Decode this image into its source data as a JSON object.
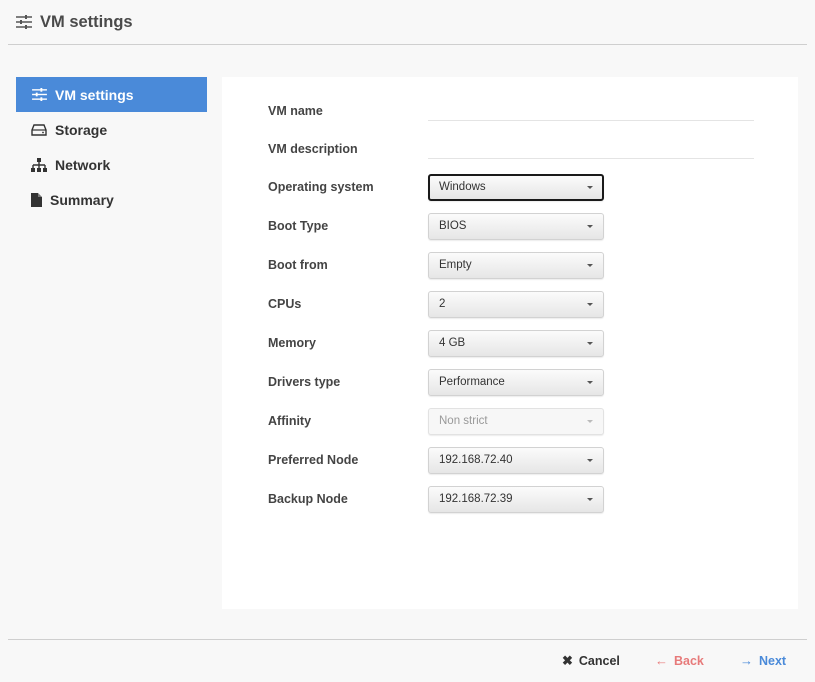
{
  "header": {
    "title": "VM settings",
    "icon": "sliders-icon"
  },
  "sidebar": {
    "items": [
      {
        "label": "VM settings",
        "icon": "sliders-icon",
        "active": true
      },
      {
        "label": "Storage",
        "icon": "hard-drive-icon",
        "active": false
      },
      {
        "label": "Network",
        "icon": "network-icon",
        "active": false
      },
      {
        "label": "Summary",
        "icon": "file-icon",
        "active": false
      }
    ]
  },
  "form": {
    "vm_name": {
      "label": "VM name",
      "value": "",
      "placeholder": ""
    },
    "vm_description": {
      "label": "VM description",
      "value": "",
      "placeholder": ""
    },
    "operating_system": {
      "label": "Operating system",
      "value": "Windows"
    },
    "boot_type": {
      "label": "Boot Type",
      "value": "BIOS"
    },
    "boot_from": {
      "label": "Boot from",
      "value": "Empty"
    },
    "cpus": {
      "label": "CPUs",
      "value": "2"
    },
    "memory": {
      "label": "Memory",
      "value": "4 GB"
    },
    "drivers_type": {
      "label": "Drivers type",
      "value": "Performance"
    },
    "affinity": {
      "label": "Affinity",
      "value": "Non strict",
      "disabled": true
    },
    "preferred_node": {
      "label": "Preferred Node",
      "value": "192.168.72.40"
    },
    "backup_node": {
      "label": "Backup Node",
      "value": "192.168.72.39"
    }
  },
  "footer": {
    "cancel": {
      "label": "Cancel",
      "icon": "close-icon",
      "glyph": "✖"
    },
    "back": {
      "label": "Back",
      "icon": "arrow-left-icon",
      "glyph": "←",
      "color": "#e77a7a"
    },
    "next": {
      "label": "Next",
      "icon": "arrow-right-icon",
      "glyph": "→",
      "color": "#4a8ad9"
    }
  },
  "colors": {
    "accent": "#4a8ad9",
    "back": "#e77a7a"
  }
}
